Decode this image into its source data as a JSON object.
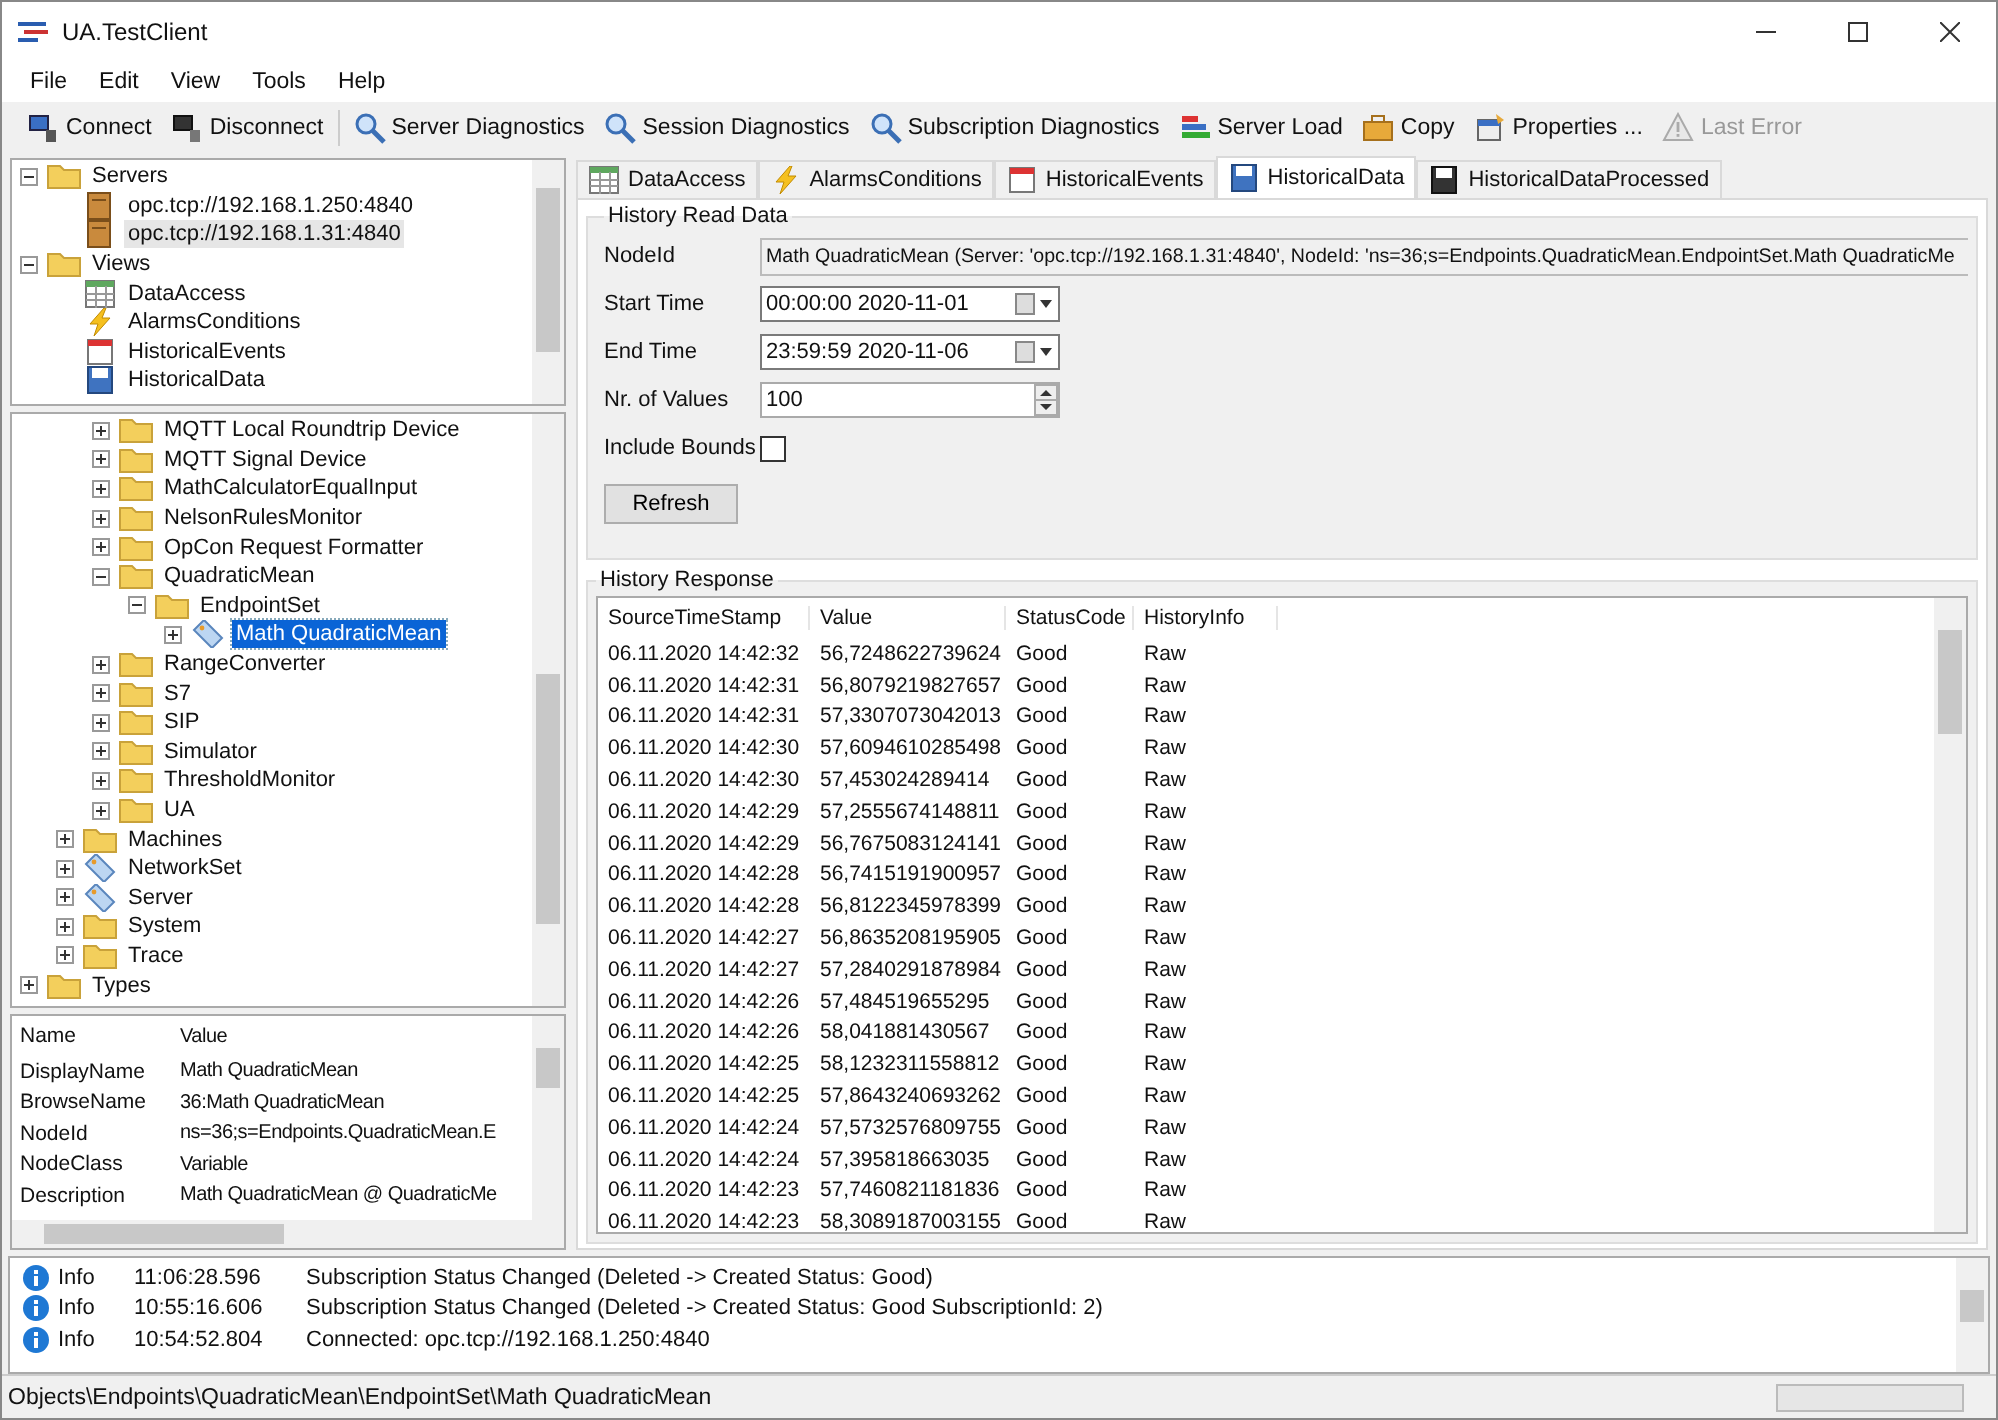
{
  "window": {
    "title": "UA.TestClient"
  },
  "menu": [
    "File",
    "Edit",
    "View",
    "Tools",
    "Help"
  ],
  "toolbar": [
    {
      "label": "Connect",
      "kind": "connect",
      "disabled": false
    },
    {
      "label": "Disconnect",
      "kind": "disconnect",
      "disabled": false
    },
    {
      "label": "Server Diagnostics",
      "kind": "diagnostics",
      "disabled": false
    },
    {
      "label": "Session Diagnostics",
      "kind": "diagnostics",
      "disabled": false
    },
    {
      "label": "Subscription Diagnostics",
      "kind": "diagnostics",
      "disabled": false
    },
    {
      "label": "Server Load",
      "kind": "load",
      "disabled": false
    },
    {
      "label": "Copy",
      "kind": "copy",
      "disabled": false
    },
    {
      "label": "Properties ...",
      "kind": "properties",
      "disabled": false
    },
    {
      "label": "Last Error",
      "kind": "error",
      "disabled": true
    }
  ],
  "server_tree": {
    "items": [
      {
        "label": "Servers",
        "kind": "folder",
        "expanded": true,
        "selected": false,
        "children": [
          {
            "label": "opc.tcp://192.168.1.250:4840",
            "kind": "server",
            "selected": false
          },
          {
            "label": "opc.tcp://192.168.1.31:4840",
            "kind": "server",
            "selected": true
          }
        ]
      },
      {
        "label": "Views",
        "kind": "folder",
        "expanded": true,
        "selected": false,
        "children": [
          {
            "label": "DataAccess",
            "kind": "view_data",
            "selected": false
          },
          {
            "label": "AlarmsConditions",
            "kind": "view_alarms",
            "selected": false
          },
          {
            "label": "HistoricalEvents",
            "kind": "view_events",
            "selected": false
          },
          {
            "label": "HistoricalData",
            "kind": "view_history",
            "selected": false
          }
        ]
      }
    ]
  },
  "browse_tree": {
    "items": [
      {
        "children": [
          {
            "children": [
              {
                "label": "MQTT Local Roundtrip Device",
                "kind": "folder",
                "expanded": false,
                "selected": false
              },
              {
                "label": "MQTT Signal Device",
                "kind": "folder",
                "expanded": false,
                "selected": false
              },
              {
                "label": "MathCalculatorEqualInput",
                "kind": "folder",
                "expanded": false,
                "selected": false
              },
              {
                "label": "NelsonRulesMonitor",
                "kind": "folder",
                "expanded": false,
                "selected": false
              },
              {
                "label": "OpCon Request Formatter",
                "kind": "folder",
                "expanded": false,
                "selected": false
              },
              {
                "label": "QuadraticMean",
                "kind": "folder",
                "expanded": true,
                "selected": false,
                "children": [
                  {
                    "label": "EndpointSet",
                    "kind": "folder",
                    "expanded": true,
                    "selected": false,
                    "children": [
                      {
                        "label": "Math QuadraticMean",
                        "kind": "variable",
                        "expanded": false,
                        "selected": true
                      }
                    ]
                  }
                ]
              },
              {
                "label": "RangeConverter",
                "kind": "folder",
                "expanded": false,
                "selected": false
              },
              {
                "label": "S7",
                "kind": "folder",
                "expanded": false,
                "selected": false
              },
              {
                "label": "SIP",
                "kind": "folder",
                "expanded": false,
                "selected": false
              },
              {
                "label": "Simulator",
                "kind": "folder",
                "expanded": false,
                "selected": false
              },
              {
                "label": "ThresholdMonitor",
                "kind": "folder",
                "expanded": false,
                "selected": false
              },
              {
                "label": "UA",
                "kind": "folder",
                "expanded": false,
                "selected": false
              }
            ]
          },
          {
            "label": "Machines",
            "kind": "folder",
            "expanded": false,
            "selected": false
          },
          {
            "label": "NetworkSet",
            "kind": "variable",
            "expanded": false,
            "selected": false
          },
          {
            "label": "Server",
            "kind": "variable",
            "expanded": false,
            "selected": false
          },
          {
            "label": "System",
            "kind": "folder",
            "expanded": false,
            "selected": false
          },
          {
            "label": "Trace",
            "kind": "folder",
            "expanded": false,
            "selected": false
          }
        ]
      },
      {
        "label": "Types",
        "kind": "folder",
        "expanded": false,
        "selected": false
      }
    ]
  },
  "properties": {
    "columns": [
      "Name",
      "Value"
    ],
    "rows": [
      [
        "DisplayName",
        "Math QuadraticMean"
      ],
      [
        "BrowseName",
        "36:Math QuadraticMean"
      ],
      [
        "NodeId",
        "ns=36;s=Endpoints.QuadraticMean.E"
      ],
      [
        "NodeClass",
        "Variable"
      ],
      [
        "Description",
        "Math QuadraticMean @ QuadraticMe"
      ]
    ]
  },
  "tabs": [
    {
      "label": "DataAccess",
      "kind": "view_data",
      "selected": false
    },
    {
      "label": "AlarmsConditions",
      "kind": "view_alarms",
      "selected": false
    },
    {
      "label": "HistoricalEvents",
      "kind": "view_events",
      "selected": false
    },
    {
      "label": "HistoricalData",
      "kind": "view_history",
      "selected": true
    },
    {
      "label": "HistoricalDataProcessed",
      "kind": "view_history_processed",
      "selected": false
    }
  ],
  "history_read": {
    "title": "History Read Data",
    "node_id": {
      "label": "NodeId",
      "value": "Math QuadraticMean (Server: 'opc.tcp://192.168.1.31:4840', NodeId: 'ns=36;s=Endpoints.QuadraticMean.EndpointSet.Math QuadraticMe"
    },
    "start_time": {
      "label": "Start Time",
      "value": "00:00:00 2020-11-01"
    },
    "end_time": {
      "label": "End Time",
      "value": "23:59:59 2020-11-06"
    },
    "nr_of_values": {
      "label": "Nr. of Values",
      "value": "100"
    },
    "include_bounds": {
      "label": "Include Bounds",
      "checked": false
    },
    "refresh_button": "Refresh"
  },
  "history_response": {
    "title": "History Response",
    "columns": [
      "SourceTimeStamp",
      "Value",
      "StatusCode",
      "HistoryInfo"
    ],
    "rows": [
      [
        "06.11.2020 14:42:32",
        "56,7248622739624",
        "Good",
        "Raw"
      ],
      [
        "06.11.2020 14:42:31",
        "56,8079219827657",
        "Good",
        "Raw"
      ],
      [
        "06.11.2020 14:42:31",
        "57,3307073042013",
        "Good",
        "Raw"
      ],
      [
        "06.11.2020 14:42:30",
        "57,6094610285498",
        "Good",
        "Raw"
      ],
      [
        "06.11.2020 14:42:30",
        "57,453024289414",
        "Good",
        "Raw"
      ],
      [
        "06.11.2020 14:42:29",
        "57,2555674148811",
        "Good",
        "Raw"
      ],
      [
        "06.11.2020 14:42:29",
        "56,7675083124141",
        "Good",
        "Raw"
      ],
      [
        "06.11.2020 14:42:28",
        "56,7415191900957",
        "Good",
        "Raw"
      ],
      [
        "06.11.2020 14:42:28",
        "56,8122345978399",
        "Good",
        "Raw"
      ],
      [
        "06.11.2020 14:42:27",
        "56,8635208195905",
        "Good",
        "Raw"
      ],
      [
        "06.11.2020 14:42:27",
        "57,2840291878984",
        "Good",
        "Raw"
      ],
      [
        "06.11.2020 14:42:26",
        "57,484519655295",
        "Good",
        "Raw"
      ],
      [
        "06.11.2020 14:42:26",
        "58,041881430567",
        "Good",
        "Raw"
      ],
      [
        "06.11.2020 14:42:25",
        "58,1232311558812",
        "Good",
        "Raw"
      ],
      [
        "06.11.2020 14:42:25",
        "57,8643240693262",
        "Good",
        "Raw"
      ],
      [
        "06.11.2020 14:42:24",
        "57,5732576809755",
        "Good",
        "Raw"
      ],
      [
        "06.11.2020 14:42:24",
        "57,395818663035",
        "Good",
        "Raw"
      ],
      [
        "06.11.2020 14:42:23",
        "57,7460821181836",
        "Good",
        "Raw"
      ],
      [
        "06.11.2020 14:42:23",
        "58,3089187003155",
        "Good",
        "Raw"
      ]
    ]
  },
  "log": [
    {
      "level": "Info",
      "time": "11:06:28.596",
      "message": "Subscription Status Changed (Deleted -> Created Status: Good)"
    },
    {
      "level": "Info",
      "time": "10:55:16.606",
      "message": "Subscription Status Changed (Deleted -> Created Status: Good SubscriptionId: 2)"
    },
    {
      "level": "Info",
      "time": "10:54:52.804",
      "message": "Connected: opc.tcp://192.168.1.250:4840"
    }
  ],
  "status_bar": {
    "path": "Objects\\Endpoints\\QuadraticMean\\EndpointSet\\Math QuadraticMean"
  }
}
